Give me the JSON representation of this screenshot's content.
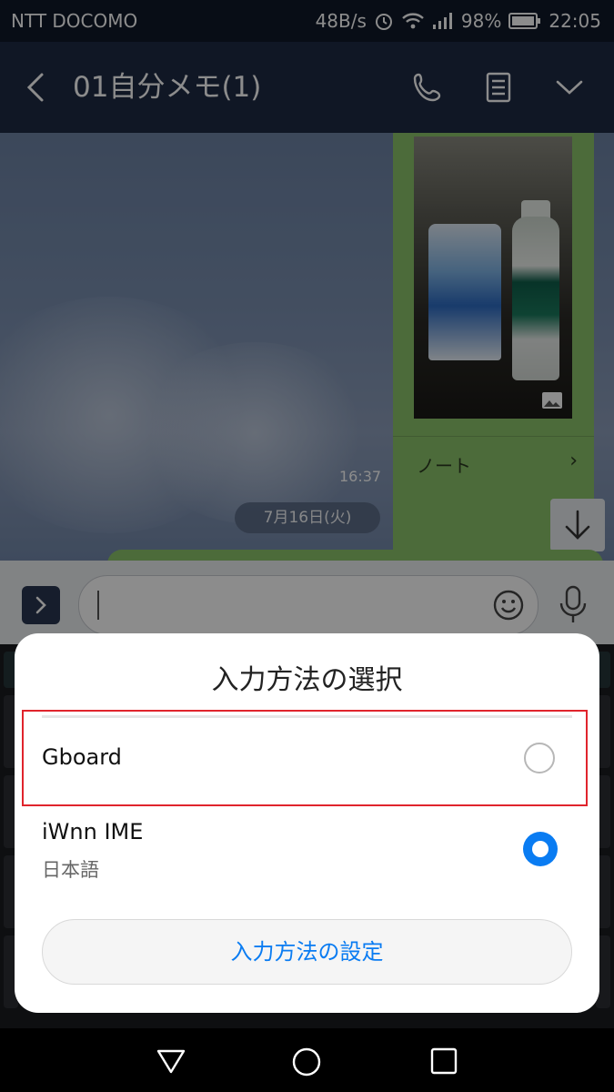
{
  "status_bar": {
    "carrier": "NTT DOCOMO",
    "speed": "48B/s",
    "battery": "98%",
    "time": "22:05",
    "icons": [
      "alarm-icon",
      "wifi-icon",
      "signal-icon",
      "battery-icon"
    ]
  },
  "header": {
    "title": "01自分メモ(1)",
    "icons": [
      "back-icon",
      "phone-icon",
      "note-icon",
      "chevron-down-icon"
    ]
  },
  "chat": {
    "link_label": "ノート",
    "link_arrow": "›",
    "message_time": "16:37",
    "date_label": "7月16日(火)"
  },
  "input_bar": {
    "icons": [
      "expand-icon",
      "emoji-icon",
      "mic-icon"
    ]
  },
  "dialog": {
    "title": "入力方法の選択",
    "options": [
      {
        "name": "Gboard",
        "subtitle": "",
        "selected": false
      },
      {
        "name": "iWnn IME",
        "subtitle": "日本語",
        "selected": true
      }
    ],
    "settings_button": "入力方法の設定"
  },
  "colors": {
    "accent": "#0a7cf2",
    "highlight": "#e0242c",
    "bubble": "#8ac36b",
    "header": "#1e2a44"
  }
}
